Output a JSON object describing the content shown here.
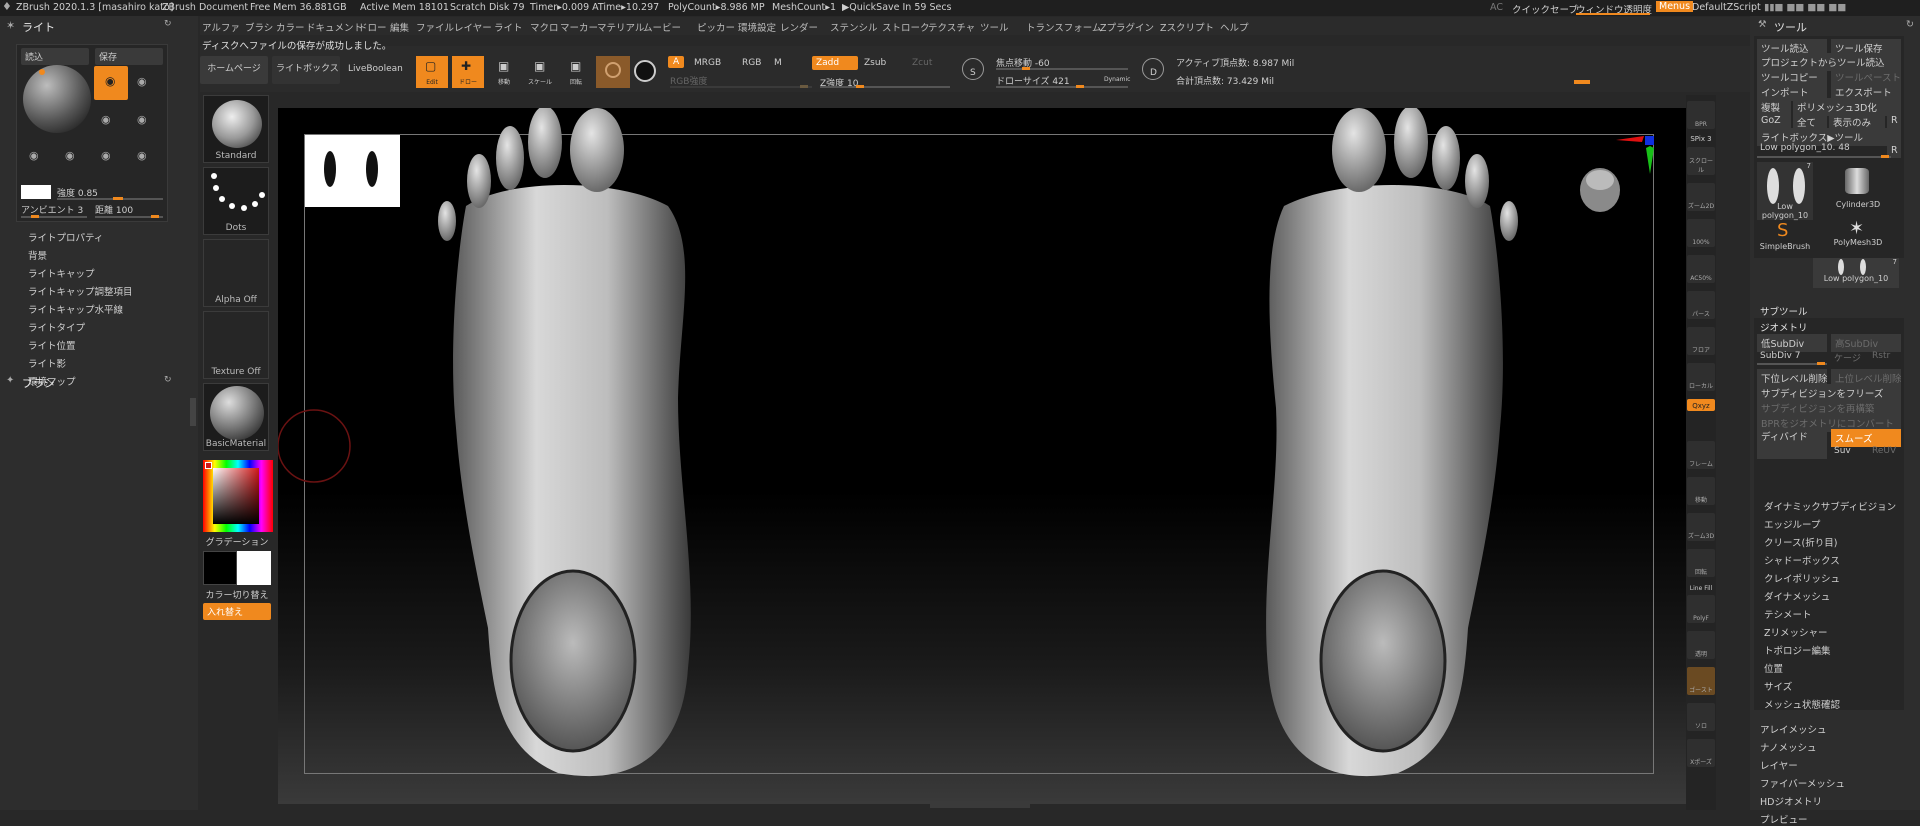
{
  "titlebar": {
    "app_title": "ZBrush 2020.1.3 [masahiro kato]",
    "document": "ZBrush Document",
    "free_mem": "Free Mem 36.881GB",
    "active_mem": "Active Mem 18101",
    "scratch_disk": "Scratch Disk 79",
    "timer": "Timer▸0.009 ATime▸10.297",
    "polycount": "PolyCount▸8.986 MP",
    "meshcount": "MeshCount▸1",
    "quicksave": "▶QuickSave In 59 Secs",
    "ac": "AC",
    "quick_save": "クイックセーブ",
    "window_transparency": "ウィンドウ透明度",
    "menus": "Menus",
    "default_zscript": "DefaultZScript"
  },
  "menu": {
    "items": [
      "アルファ",
      "ブラシ",
      "カラー",
      "ドキュメント",
      "ドロー",
      "編集",
      "ファイル",
      "レイヤー",
      "ライト",
      "マクロ",
      "マーカー",
      "マテリアル",
      "ムービー",
      "ピッカー",
      "環境設定",
      "レンダー",
      "ステンシル",
      "ストローク",
      "テクスチャ",
      "ツール",
      "トランスフォーム",
      "Zプラグイン",
      "Zスクリプト",
      "ヘルプ"
    ]
  },
  "status": {
    "message": "ディスクへファイルの保存が成功しました。"
  },
  "light_panel": {
    "title": "ライト",
    "load": "読込",
    "save": "保存",
    "intensity": "強度 0.85",
    "ambient": "アンビエント 3",
    "distance": "距離 100",
    "items": [
      "ライトプロパティ",
      "背景",
      "ライトキャップ",
      "ライトキャップ調整項目",
      "ライトキャップ水平線",
      "ライトタイプ",
      "ライト位置",
      "ライト影",
      "環境マップ"
    ],
    "brush_header": "ブラシ"
  },
  "brush_col": {
    "standard": "Standard",
    "dots": "Dots",
    "alpha": "Alpha Off",
    "texture": "Texture Off",
    "material": "BasicMaterial",
    "gradation": "グラデーション",
    "color_switch": "カラー切り替え",
    "swap": "入れ替え"
  },
  "toolbar": {
    "home": "ホームページ",
    "lightbox": "ライトボックス",
    "liveboolean": "LiveBoolean",
    "edit": "Edit",
    "draw": "ドロー",
    "move": "移動",
    "scale": "スケール",
    "rotate": "回転",
    "a": "A",
    "mrgb": "MRGB",
    "rgb": "RGB",
    "m": "M",
    "zadd": "Zadd",
    "zsub": "Zsub",
    "zcut": "Zcut",
    "rgb_intensity": "RGB強度",
    "z_intensity": "Z強度 10",
    "focal_shift": "焦点移動 -60",
    "draw_size": "ドローサイズ 421",
    "dynamic": "Dynamic",
    "active_points": "アクティブ頂点数: 8.987 Mil",
    "total_points": "合計頂点数: 73.429 Mil"
  },
  "shelf": {
    "bpr": "BPR",
    "spix": "SPix 3",
    "scroll": "スクロール",
    "zoom2d": "ズーム2D",
    "hundred": "100%",
    "ac50": "AC50%",
    "persp": "パース",
    "floor": "フロア",
    "local": "ローカル",
    "xyz": "Qxyz",
    "frame": "フレーム",
    "move": "移動",
    "zoom3d": "ズーム3D",
    "rotate": "回転",
    "linefill": "Line Fill",
    "polyf": "PolyF",
    "transp": "透明",
    "ghost": "ゴースト",
    "solo": "ソロ",
    "xpose": "Xポーズ"
  },
  "tool_panel": {
    "title": "ツール",
    "load_tool": "ツール読込",
    "save_tool": "ツール保存",
    "load_from_project": "プロジェクトからツール読込",
    "copy_tool": "ツールコピー",
    "paste_tool": "ツールペースト",
    "import": "インポート",
    "export": "エクスポート",
    "clone": "複製",
    "polymesh3d": "ポリメッシュ3D化",
    "goz": "GoZ",
    "all": "全て",
    "visible_only": "表示のみ",
    "r": "R",
    "lightbox_tool": "ライトボックス▶ツール",
    "current_tool": "Low polygon_10. 48",
    "thumb1": "Low polygon_10",
    "thumb1_count": "7",
    "thumb2": "Cylinder3D",
    "thumb3": "PolyMesh3D",
    "thumb4": "SimpleBrush",
    "thumb5": "Low polygon_10",
    "thumb5_count": "7",
    "subtool": "サブツール",
    "geometry": "ジオメトリ",
    "lower_subdiv": "低SubDiv",
    "higher_subdiv": "高SubDiv",
    "subdiv": "SubDiv 7",
    "cage": "ケージ",
    "rstr": "Rstr",
    "del_lower": "下位レベル削除",
    "del_higher": "上位レベル削除",
    "freeze": "サブディビジョンをフリーズ",
    "reconstruct": "サブディビジョンを再構築",
    "bpr_convert": "BPRをジオメトリにコンバート",
    "divide": "ディバイド",
    "smooth": "スムーズ",
    "suv": "Suv",
    "reuv": "ReUV",
    "list": [
      "ダイナミックサブディビジョン",
      "エッジループ",
      "クリース(折り目)",
      "シャドーボックス",
      "クレイポリッシュ",
      "ダイナメッシュ",
      "テシメート",
      "Zリメッシャー",
      "トポロジー編集",
      "位置",
      "サイズ",
      "メッシュ状態確認"
    ],
    "list2": [
      "アレイメッシュ",
      "ナノメッシュ",
      "レイヤー",
      "ファイバーメッシュ",
      "HDジオメトリ",
      "プレビュー"
    ]
  },
  "colors": {
    "accent": "#f0891e",
    "panel": "#2d2d2d",
    "canvas": "#000000"
  }
}
